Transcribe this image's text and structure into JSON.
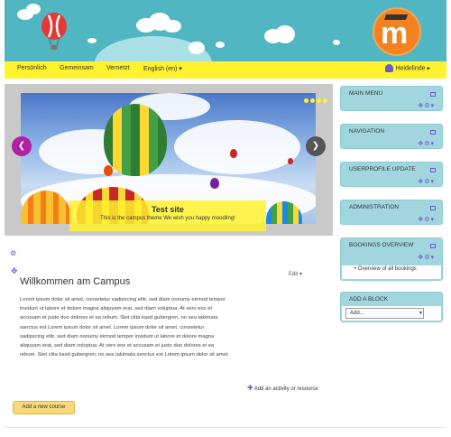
{
  "nav": {
    "items": [
      "Persönlich",
      "Gemeinsam",
      "Vernetzt",
      "English (en) ▾"
    ],
    "user": "Heidelinde ▸"
  },
  "slider": {
    "caption_title": "Test site",
    "caption_subtitle": "This is the campus theme We wish you happy moodling!",
    "prev": "❮",
    "next": "❯"
  },
  "content": {
    "edit_label": "Edit ▾",
    "title": "Willkommen am Campus",
    "body": "Lorem ipsum dolor sit amet, consetetur sadipscing elitr, sed diam nonumy eirmod tempor invidunt ut labore et dolore magna aliquyam erat, sed diam voluptua. At vero eos et accusam et justo duo dolores et ea rebum. Stet clita kasd gubergren, no sea takimata sanctus est Lorem ipsum dolor sit amet. Lorem ipsum dolor sit amet, consetetur sadipscing elitr, sed diam nonumy eirmod tempor invidunt ut labore et dolore magna aliquyam erat, sed diam voluptua. At vero eos et accusam et justo duo dolores et ea rebum. Stet clita kasd gubergren, no sea takimata sanctus est Lorem ipsum dolor sit amet.",
    "add_activity": "Add an activity or resource",
    "add_course": "Add a new course"
  },
  "blocks": {
    "main_menu": "MAIN MENU",
    "navigation": "NAVIGATION",
    "userprofile": "USERPROFILE UPDATE",
    "administration": "ADMINISTRATION",
    "bookings": "BOOKINGS OVERVIEW",
    "bookings_item": "Overview of all bookings",
    "add_block": "ADD A BLOCK",
    "add_select": "Add..."
  },
  "colors": {
    "header": "#4fb6c2",
    "navbar": "#fff22e",
    "block": "#a2d6df",
    "accent": "#6a5acd",
    "logo": "#f58220"
  }
}
